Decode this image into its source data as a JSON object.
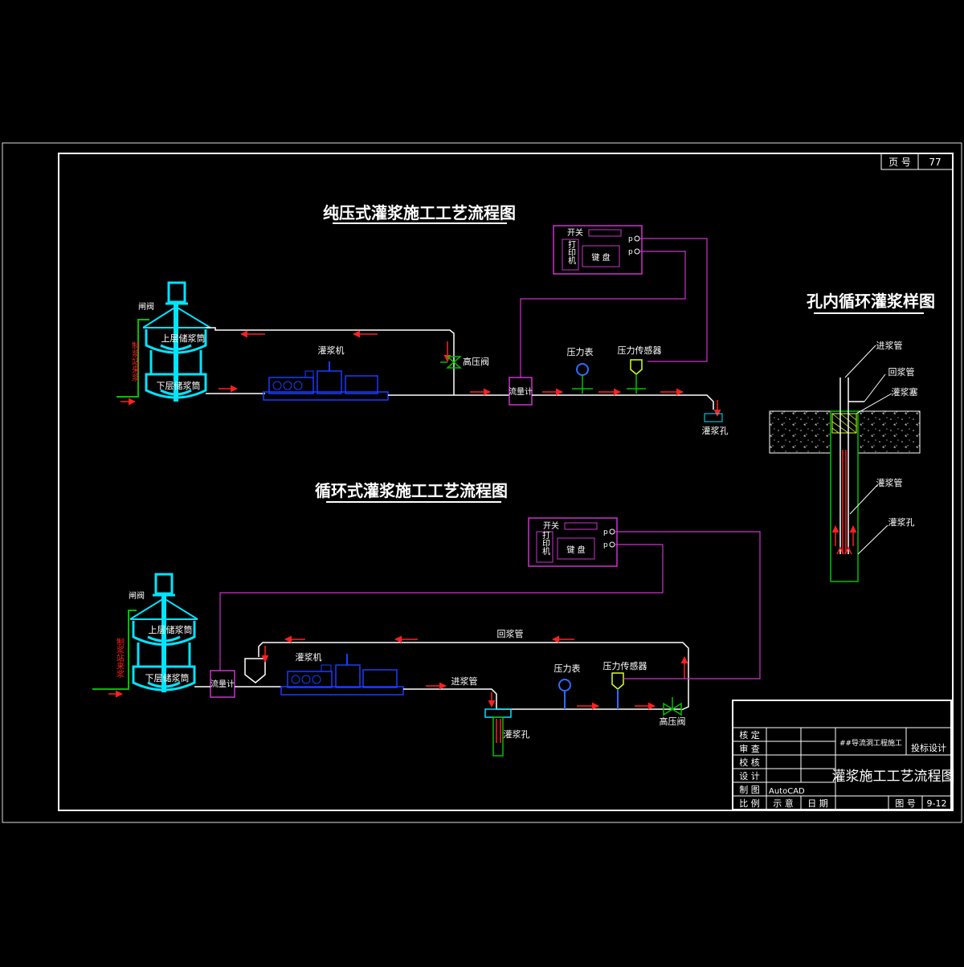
{
  "sheet": {
    "page_label": "页 号",
    "page_no": "77"
  },
  "colors": {
    "background": "#000000",
    "frame": "#ffffff",
    "tank": "#00e5ff",
    "pump": "#1a3cff",
    "instrument_box": "#cc33cc",
    "flow_arrow": "#ff2020",
    "supply_line": "#00c000",
    "valve": "#00c000",
    "gauge": "#2e6bff",
    "sensor": "#d8ff20"
  },
  "diagram1": {
    "title": "纯压式灌浆施工工艺流程图",
    "gate_valve": "闸阀",
    "upper_tank": "上层储浆筒",
    "lower_tank": "下层储浆筒",
    "supply_label": "制浆站来浆",
    "pump": "灌浆机",
    "relief_valve": "高压阀",
    "flow_meter": "流量计",
    "pressure_gauge": "压力表",
    "pressure_sensor": "压力传感器",
    "grout_hole": "灌浆孔",
    "recorder": {
      "switch": "开关",
      "printer": "打印机",
      "keyboard": "键 盘",
      "port_p": "p"
    }
  },
  "diagram2": {
    "title": "循环式灌浆施工工艺流程图",
    "gate_valve": "闸阀",
    "upper_tank": "上层储浆筒",
    "lower_tank": "下层储浆筒",
    "supply_label": "制浆站来浆",
    "pump": "灌浆机",
    "flow_meter": "流量计",
    "return_pipe": "回浆管",
    "feed_pipe": "进浆管",
    "pressure_gauge": "压力表",
    "pressure_sensor": "压力传感器",
    "relief_valve": "高压阀",
    "grout_hole": "灌浆孔",
    "recorder": {
      "switch": "开关",
      "printer": "打印机",
      "keyboard": "键 盘",
      "port_p": "p"
    }
  },
  "diagram3": {
    "title": "孔内循环灌浆样图",
    "feed_pipe": "进浆管",
    "return_pipe": "回浆管",
    "packer": "灌浆塞",
    "grout_tube": "灌浆管",
    "grout_hole": "灌浆孔"
  },
  "title_block": {
    "rows": [
      "核 定",
      "审 查",
      "校 核",
      "设 计",
      "制 图",
      "比 例"
    ],
    "autocad": "AutoCAD",
    "scale_value": "示 意",
    "date_label": "日 期",
    "project": "##导流洞工程施工",
    "stage": "投标设计",
    "drawing_title": "灌浆施工工艺流程图",
    "figno_label": "图 号",
    "figno": "9-12"
  }
}
